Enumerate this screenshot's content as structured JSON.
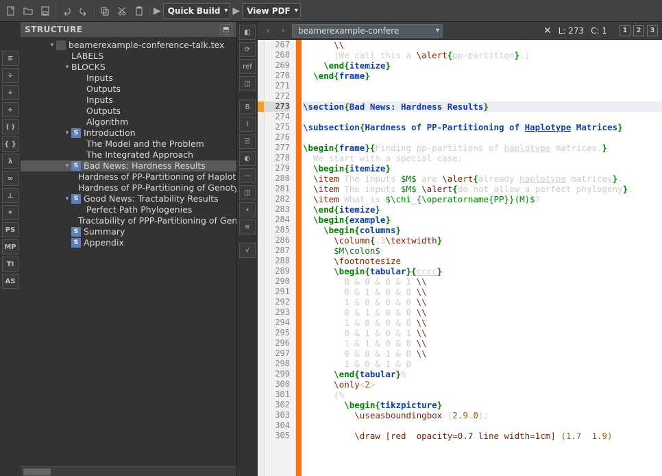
{
  "toolbar": {
    "quickbuild": "Quick Build",
    "viewpdf": "View PDF"
  },
  "structure": {
    "title": "STRUCTURE",
    "tree": [
      {
        "depth": 0,
        "tw": "▾",
        "icon": "doc",
        "label": "beamerexample-conference-talk.tex"
      },
      {
        "depth": 1,
        "tw": "",
        "icon": "",
        "label": "LABELS"
      },
      {
        "depth": 1,
        "tw": "▾",
        "icon": "",
        "label": "BLOCKS"
      },
      {
        "depth": 2,
        "tw": "",
        "icon": "",
        "label": "Inputs"
      },
      {
        "depth": 2,
        "tw": "",
        "icon": "",
        "label": "Outputs"
      },
      {
        "depth": 2,
        "tw": "",
        "icon": "",
        "label": "Inputs"
      },
      {
        "depth": 2,
        "tw": "",
        "icon": "",
        "label": "Outputs"
      },
      {
        "depth": 2,
        "tw": "",
        "icon": "",
        "label": "Algorithm"
      },
      {
        "depth": 1,
        "tw": "▾",
        "icon": "s",
        "label": "Introduction"
      },
      {
        "depth": 2,
        "tw": "",
        "icon": "",
        "label": "The Model and the Problem"
      },
      {
        "depth": 2,
        "tw": "",
        "icon": "",
        "label": "The Integrated Approach"
      },
      {
        "depth": 1,
        "tw": "▾",
        "icon": "s",
        "label": "Bad News: Hardness Results",
        "sel": true
      },
      {
        "depth": 2,
        "tw": "",
        "icon": "",
        "label": "Hardness of PP-Partitioning of Haploty"
      },
      {
        "depth": 2,
        "tw": "",
        "icon": "",
        "label": "Hardness of PP-Partitioning of Genotyp"
      },
      {
        "depth": 1,
        "tw": "▾",
        "icon": "s",
        "label": "Good News: Tractability Results"
      },
      {
        "depth": 2,
        "tw": "",
        "icon": "",
        "label": "Perfect Path Phylogenies"
      },
      {
        "depth": 2,
        "tw": "",
        "icon": "",
        "label": "Tractability of PPP-Partitioning of Genc"
      },
      {
        "depth": 1,
        "tw": "",
        "icon": "s",
        "label": "Summary"
      },
      {
        "depth": 1,
        "tw": "",
        "icon": "s",
        "label": "Appendix"
      }
    ]
  },
  "editor": {
    "doc": "beamerexample-confere",
    "posL": "L: 273",
    "posC": "C: 1",
    "marks": [
      "1",
      "2",
      "3"
    ],
    "startLine": 267,
    "curLine": 273,
    "warnLine": 273,
    "lines": [
      "      <span class='cmd'>\\\\</span>",
      "      (We call this a <span class='cmd'>\\alert</span><span class='br'>{</span>pp-partition<span class='br'>}</span>.)",
      "    <span class='kw'>\\end</span><span class='br'>{</span><span class='arg'>itemize</span><span class='br'>}</span>",
      "  <span class='kw'>\\end</span><span class='br'>{</span><span class='arg'>frame</span><span class='br'>}</span>",
      "",
      "",
      "<span class='k'>\\section</span><span class='br'>{</span><span class='arg'>Bad News: Hardness Results</span><span class='br'>}</span>",
      "",
      "<span class='k'>\\subsection</span><span class='br'>{</span><span class='arg'>Hardness of PP-Partitioning of <span class='u'>Haplotype</span> Matrices</span><span class='br'>}</span>",
      "",
      "<span class='kw'>\\begin</span><span class='br'>{</span><span class='arg'>frame</span><span class='br'>}{</span>Finding pp-partitions of <span class='u'>haplotype</span> matrices.<span class='br'>}</span>",
      "  We start with a special case:",
      "  <span class='kw'>\\begin</span><span class='br'>{</span><span class='arg'>itemize</span><span class='br'>}</span>",
      "  <span class='cmd'>\\item</span> The inputs <span class='m-math'>$M$</span> are <span class='cmd'>\\alert</span><span class='br'>{</span>already <span class='u'>haplotype</span> matrices<span class='br'>}</span>.",
      "  <span class='cmd'>\\item</span> The inputs <span class='m-math'>$M$</span> <span class='cmd'>\\alert</span><span class='br'>{</span>do not allow a perfect phylogeny<span class='br'>}</span>.",
      "  <span class='cmd'>\\item</span> What is <span class='m-math'>$\\chi_{\\operatorname{PP}}(M)$</span>?",
      "  <span class='kw'>\\end</span><span class='br'>{</span><span class='arg'>itemize</span><span class='br'>}</span>",
      "  <span class='kw'>\\begin</span><span class='br'>{</span><span class='arg'>example</span><span class='br'>}</span>",
      "    <span class='kw'>\\begin</span><span class='br'>{</span><span class='arg'>columns</span><span class='br'>}</span>",
      "      <span class='cmd'>\\column</span><span class='br'>{</span>.3<span class='cmd'>\\textwidth</span><span class='br'>}</span>",
      "      <span class='m-math'>$M\\colon$</span>",
      "      <span class='cmd'>\\footnotesize</span>",
      "      <span class='kw'>\\begin</span><span class='br'>{</span><span class='arg'>tabular</span><span class='br'>}{</span><span class='u'>cccc</span><span class='br'>}</span>",
      "        0 &amp; 0 &amp; 0 &amp; 1 <span class='cmd'>\\\\</span>",
      "        0 &amp; 1 &amp; 0 &amp; 0 <span class='cmd'>\\\\</span>",
      "        1 &amp; 0 &amp; 0 &amp; 0 <span class='cmd'>\\\\</span>",
      "        0 &amp; 1 &amp; 0 &amp; 0 <span class='cmd'>\\\\</span>",
      "        1 &amp; 0 &amp; 0 &amp; 0 <span class='cmd'>\\\\</span>",
      "        0 &amp; 1 &amp; 0 &amp; 1 <span class='cmd'>\\\\</span>",
      "        1 &amp; 1 &amp; 0 &amp; 0 <span class='cmd'>\\\\</span>",
      "        0 &amp; 0 &amp; 1 &amp; 0 <span class='cmd'>\\\\</span>",
      "        1 &amp; 0 &amp; 1 &amp; 0",
      "      <span class='kw'>\\end</span><span class='br'>{</span><span class='arg'>tabular</span><span class='br'>}</span>%",
      "      <span class='cmd'>\\only</span>&lt;<span class='num'>2</span>&gt;",
      "      {%",
      "        <span class='kw'>\\begin</span><span class='br'>{</span><span class='arg'>tikzpicture</span><span class='br'>}</span>",
      "          <span class='cmd'>\\useasboundingbox</span> (<span class='num'>2.9</span>,<span class='num'>0</span>);",
      "",
      "          <span class='cmd'>\\draw</span> <span class='tok-red'>[red  opacity=0.7 line width=1cm]</span> <span class='num'>(1.7  1.9)</span>"
    ],
    "lineNumbers": [
      267,
      268,
      269,
      270,
      271,
      272,
      273,
      274,
      275,
      276,
      277,
      278,
      279,
      280,
      281,
      282,
      283,
      284,
      285,
      286,
      287,
      288,
      289,
      290,
      291,
      292,
      293,
      294,
      295,
      296,
      297,
      298,
      299,
      300,
      301,
      302,
      303,
      304,
      305
    ]
  },
  "sideLeft": [
    "≡",
    "÷",
    "÷",
    "÷",
    "( )",
    "{ }",
    "λ",
    "∞",
    "⊥",
    "✶",
    "PS",
    "MP",
    "TI",
    "AS"
  ],
  "vtool": [
    "◧",
    "⟳",
    "ref",
    "◫",
    "",
    "B",
    "I",
    "☰",
    "◐",
    "—",
    "◫",
    "•",
    "≡",
    "",
    "√"
  ]
}
